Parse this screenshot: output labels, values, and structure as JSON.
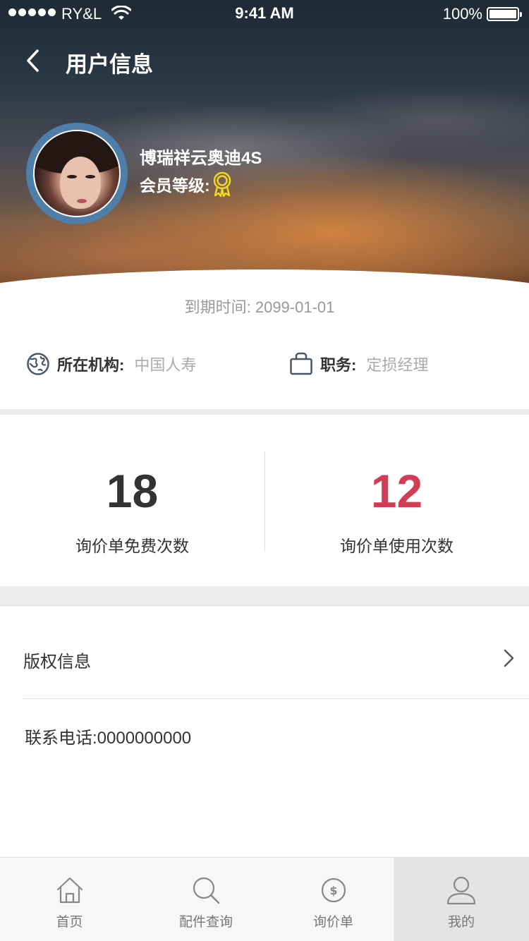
{
  "status_bar": {
    "carrier": "RY&L",
    "time": "9:41 AM",
    "battery": "100%",
    "wifi_icon": "wifi-icon",
    "battery_level": 1.0
  },
  "nav": {
    "title": "用户信息",
    "back_icon": "chevron-left-icon"
  },
  "profile": {
    "company": "博瑞祥云奥迪4S",
    "level_label": "会员等级:",
    "level_icon": "medal-icon",
    "level_icon_color": "#f2d81c",
    "expiry_label": "到期时间:",
    "expiry_date": "2099-01-01"
  },
  "org": {
    "label": "所在机构:",
    "value": "中国人寿",
    "icon": "globe-icon"
  },
  "role": {
    "label": "职务:",
    "value": "定损经理",
    "icon": "briefcase-icon"
  },
  "stats": {
    "free": {
      "value": "18",
      "label": "询价单免费次数",
      "color": "#333333"
    },
    "used": {
      "value": "12",
      "label": "询价单使用次数",
      "color": "#d23c55"
    }
  },
  "list": {
    "copyright": "版权信息",
    "phone": "联系电话:0000000000"
  },
  "tabbar": {
    "items": [
      {
        "label": "首页",
        "icon": "home-icon"
      },
      {
        "label": "配件查询",
        "icon": "search-icon"
      },
      {
        "label": "询价单",
        "icon": "dollar-circle-icon"
      },
      {
        "label": "我的",
        "icon": "user-icon",
        "active": true
      }
    ]
  }
}
